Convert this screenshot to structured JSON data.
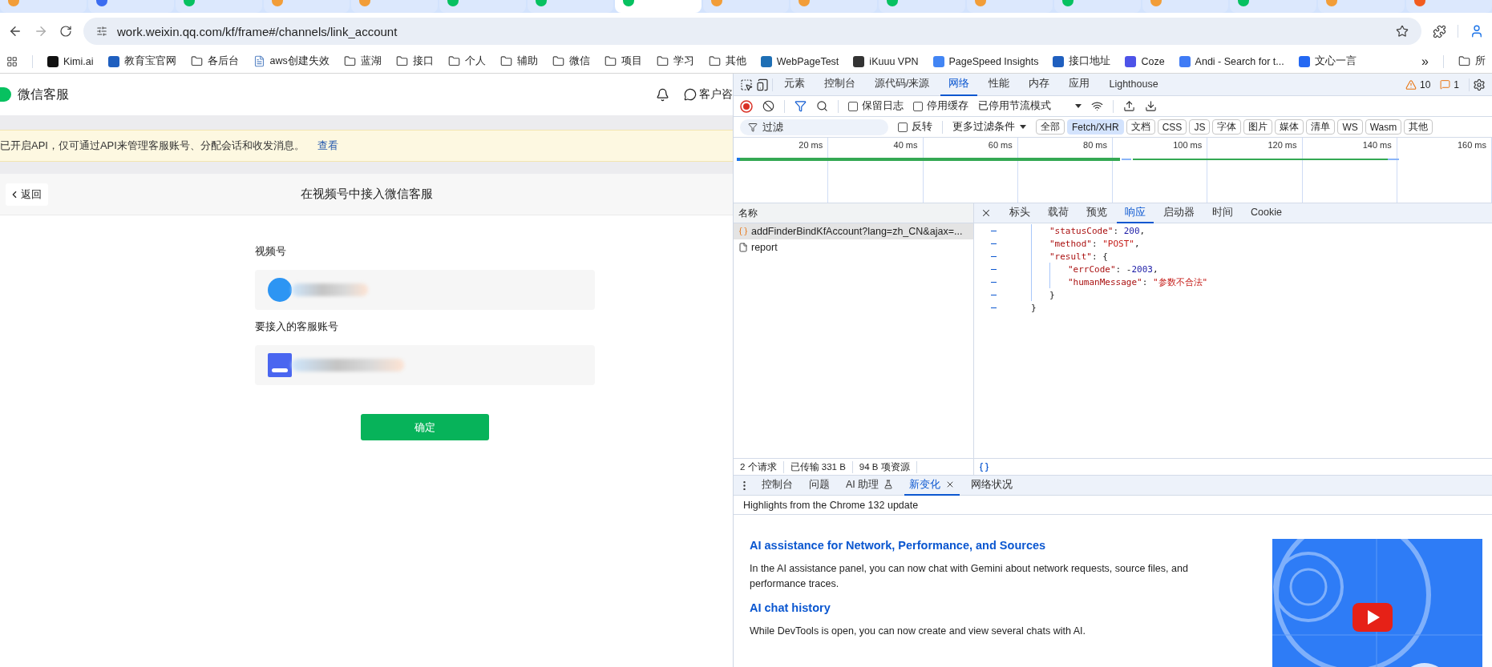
{
  "browser": {
    "tabs": [
      {
        "selected": false,
        "color": "#f29d38"
      },
      {
        "selected": false,
        "color": "#3b6cf0"
      },
      {
        "selected": false,
        "color": "#07c160"
      },
      {
        "selected": false,
        "color": "#f29d38"
      },
      {
        "selected": false,
        "color": "#f29d38"
      },
      {
        "selected": false,
        "color": "#07c160"
      },
      {
        "selected": false,
        "color": "#07c160"
      },
      {
        "selected": true,
        "color": "#07c160"
      },
      {
        "selected": false,
        "color": "#f29d38"
      },
      {
        "selected": false,
        "color": "#f29d38"
      },
      {
        "selected": false,
        "color": "#07c160"
      },
      {
        "selected": false,
        "color": "#f29d38"
      },
      {
        "selected": false,
        "color": "#07c160"
      },
      {
        "selected": false,
        "color": "#f29d38"
      },
      {
        "selected": false,
        "color": "#07c160"
      },
      {
        "selected": false,
        "color": "#f29d38"
      },
      {
        "selected": false,
        "color": "#f25c1f"
      }
    ],
    "address": "work.weixin.qq.com/kf/frame#/channels/link_account",
    "bookmarks": [
      {
        "kind": "site",
        "label": "Kimi.ai",
        "color": "#111111"
      },
      {
        "kind": "site",
        "label": "教育宝官网",
        "color": "#1f5fbf"
      },
      {
        "kind": "folder",
        "label": "各后台"
      },
      {
        "kind": "doc",
        "label": "aws创建失效"
      },
      {
        "kind": "folder",
        "label": "蓝湖"
      },
      {
        "kind": "folder",
        "label": "接口"
      },
      {
        "kind": "folder",
        "label": "个人"
      },
      {
        "kind": "folder",
        "label": "辅助"
      },
      {
        "kind": "folder",
        "label": "微信"
      },
      {
        "kind": "folder",
        "label": "项目"
      },
      {
        "kind": "folder",
        "label": "学习"
      },
      {
        "kind": "folder",
        "label": "其他"
      },
      {
        "kind": "site",
        "label": "WebPageTest",
        "color": "#1e6fb5"
      },
      {
        "kind": "site",
        "label": "iKuuu VPN",
        "color": "#333333"
      },
      {
        "kind": "site",
        "label": "PageSpeed Insights",
        "color": "#4285f4"
      },
      {
        "kind": "site",
        "label": "接口地址",
        "color": "#1f5fbf"
      },
      {
        "kind": "site",
        "label": "Coze",
        "color": "#4d53e8"
      },
      {
        "kind": "site",
        "label": "Andi - Search for t...",
        "color": "#3f7bf5"
      },
      {
        "kind": "site",
        "label": "文心一言",
        "color": "#2468f2"
      }
    ],
    "more_bookmarks": "»",
    "all_bookmarks": "所"
  },
  "page": {
    "brand": "微信客服",
    "header_link": "客户咨",
    "notice": {
      "text": "已开启API，仅可通过API来管理客服账号、分配会话和收发消息。",
      "link": "查看"
    },
    "back": "返回",
    "title": "在视频号中接入微信客服",
    "fields": [
      {
        "label": "视频号",
        "kind": "channel"
      },
      {
        "label": "要接入的客服账号",
        "kind": "account"
      }
    ],
    "submit": "确定"
  },
  "devtools": {
    "panels": [
      {
        "label": "元素",
        "selected": false
      },
      {
        "label": "控制台",
        "selected": false
      },
      {
        "label": "源代码/来源",
        "selected": false
      },
      {
        "label": "网络",
        "selected": true
      },
      {
        "label": "性能",
        "selected": false
      },
      {
        "label": "内存",
        "selected": false
      },
      {
        "label": "应用",
        "selected": false
      },
      {
        "label": "Lighthouse",
        "selected": false
      }
    ],
    "warnings": "10",
    "issues": "1",
    "preserve_log": {
      "label": "保留日志",
      "checked": false
    },
    "disable_cache": {
      "label": "停用缓存",
      "checked": false
    },
    "throttling": "已停用节流模式",
    "filter": {
      "placeholder": "过滤",
      "invert": {
        "label": "反转",
        "checked": false
      },
      "more": "更多过滤条件",
      "types": [
        {
          "label": "全部",
          "selected": false
        },
        {
          "label": "Fetch/XHR",
          "selected": true
        },
        {
          "label": "文档",
          "selected": false
        },
        {
          "label": "CSS",
          "selected": false
        },
        {
          "label": "JS",
          "selected": false
        },
        {
          "label": "字体",
          "selected": false
        },
        {
          "label": "图片",
          "selected": false
        },
        {
          "label": "媒体",
          "selected": false
        },
        {
          "label": "清单",
          "selected": false
        },
        {
          "label": "WS",
          "selected": false
        },
        {
          "label": "Wasm",
          "selected": false
        },
        {
          "label": "其他",
          "selected": false
        }
      ]
    },
    "timeline": {
      "ticks": [
        "20 ms",
        "40 ms",
        "60 ms",
        "80 ms",
        "100 ms",
        "120 ms",
        "140 ms",
        "160 ms"
      ]
    },
    "requests": {
      "header": "名称",
      "rows": [
        {
          "name": "addFinderBindKfAccount?lang=zh_CN&ajax=...",
          "kind": "xhr",
          "selected": true
        },
        {
          "name": "report",
          "kind": "doc",
          "selected": false
        }
      ]
    },
    "detail_tabs": [
      {
        "label": "标头",
        "selected": false
      },
      {
        "label": "载荷",
        "selected": false
      },
      {
        "label": "预览",
        "selected": false
      },
      {
        "label": "响应",
        "selected": true
      },
      {
        "label": "启动器",
        "selected": false
      },
      {
        "label": "时间",
        "selected": false
      },
      {
        "label": "Cookie",
        "selected": false
      }
    ],
    "code": {
      "lines": [
        {
          "tokens": [
            {
              "kind": "key",
              "text": "\"statusCode\""
            },
            {
              "kind": "punct",
              "text": ": "
            },
            {
              "kind": "number",
              "text": "200"
            },
            {
              "kind": "punct",
              "text": ","
            }
          ]
        },
        {
          "tokens": [
            {
              "kind": "key",
              "text": "\"method\""
            },
            {
              "kind": "punct",
              "text": ": "
            },
            {
              "kind": "string",
              "text": "\"POST\""
            },
            {
              "kind": "punct",
              "text": ","
            }
          ]
        },
        {
          "tokens": [
            {
              "kind": "key",
              "text": "\"result\""
            },
            {
              "kind": "punct",
              "text": ": {"
            }
          ],
          "children": [
            {
              "tokens": [
                {
                  "kind": "key",
                  "text": "\"errCode\""
                },
                {
                  "kind": "punct",
                  "text": ": -"
                },
                {
                  "kind": "number",
                  "text": "2003"
                },
                {
                  "kind": "punct",
                  "text": ","
                }
              ]
            },
            {
              "tokens": [
                {
                  "kind": "key",
                  "text": "\"humanMessage\""
                },
                {
                  "kind": "punct",
                  "text": ": "
                },
                {
                  "kind": "string",
                  "text": "\"参数不合法\""
                }
              ]
            }
          ]
        },
        {
          "tokens": [
            {
              "kind": "punct",
              "text": "}"
            }
          ]
        }
      ],
      "closing": "}"
    },
    "status": [
      "2 个请求",
      "已传输 331 B",
      "94 B 项资源"
    ],
    "drawer_tabs": [
      {
        "label": "控制台",
        "selected": false,
        "kind": "plain"
      },
      {
        "label": "问题",
        "selected": false,
        "kind": "plain"
      },
      {
        "label": "AI 助理",
        "selected": false,
        "kind": "lab"
      },
      {
        "label": "新变化",
        "selected": true,
        "kind": "closable"
      },
      {
        "label": "网络状况",
        "selected": false,
        "kind": "plain"
      }
    ],
    "highlights": "Highlights from the Chrome 132 update",
    "articles": [
      {
        "title": "AI assistance for Network, Performance, and Sources",
        "body": "In the AI assistance panel, you can now chat with Gemini about network requests, source files, and performance traces."
      },
      {
        "title": "AI chat history",
        "body": "While DevTools is open, you can now create and view several chats with AI."
      }
    ]
  }
}
